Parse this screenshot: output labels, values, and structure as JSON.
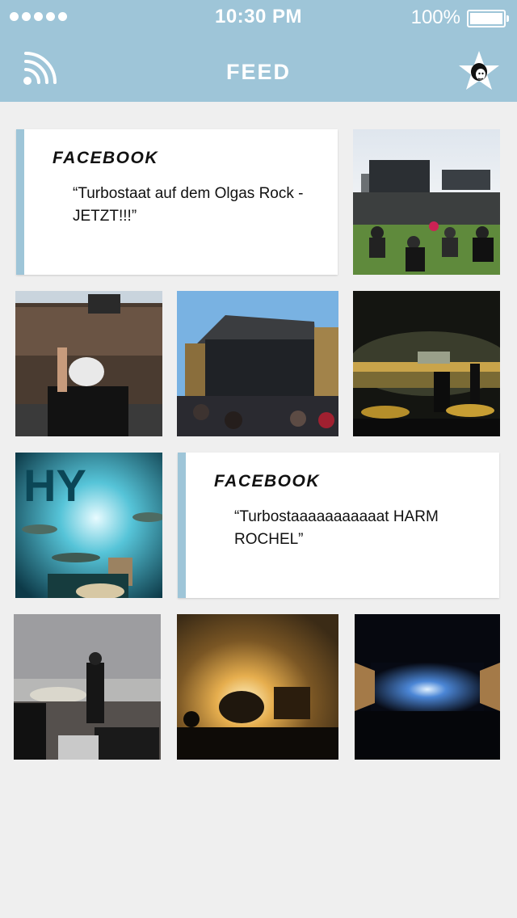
{
  "status_bar": {
    "time": "10:30 PM",
    "battery": "100%"
  },
  "nav": {
    "title": "FEED",
    "left_icon": "rss-icon",
    "right_icon": "profile-star-icon"
  },
  "feed": {
    "posts": [
      {
        "source": "FACEBOOK",
        "text": "“Turbostaat auf dem Olgas Rock - JETZT!!!”"
      },
      {
        "source": "FACEBOOK",
        "text": "“Turbostaaaaaaaaaaat HARM ROCHEL”"
      }
    ],
    "photos": [
      "photo-crowd-field",
      "photo-crowd-cap",
      "photo-stage-day",
      "photo-stage-night",
      "photo-drummer",
      "photo-rapper",
      "photo-sunset",
      "photo-blue-stage"
    ]
  },
  "colors": {
    "accent": "#9ec5d8",
    "background": "#efefef",
    "card": "#ffffff"
  }
}
